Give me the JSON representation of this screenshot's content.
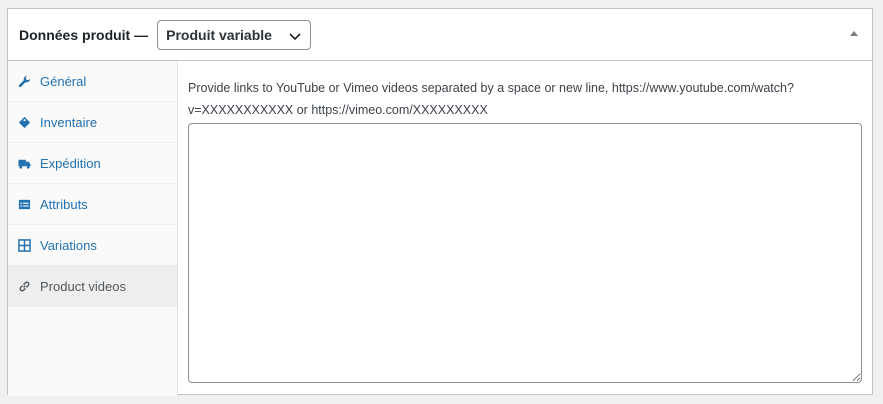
{
  "header": {
    "title": "Données produit —",
    "product_type": "Produit variable"
  },
  "tabs": [
    {
      "label": "Général",
      "icon": "wrench-icon"
    },
    {
      "label": "Inventaire",
      "icon": "tag-icon"
    },
    {
      "label": "Expédition",
      "icon": "truck-icon"
    },
    {
      "label": "Attributs",
      "icon": "list-icon"
    },
    {
      "label": "Variations",
      "icon": "grid-icon"
    },
    {
      "label": "Product videos",
      "icon": "link-icon"
    }
  ],
  "active_tab": "Product videos",
  "videos": {
    "description_line1": "Provide links to YouTube or Vimeo videos separated by a space or new line, https://www.youtube.com/watch?",
    "description_line2": "v=XXXXXXXXXXX or https://vimeo.com/XXXXXXXXX",
    "value": ""
  },
  "colors": {
    "link": "#2271b1",
    "active_tab_bg": "#eeeeee",
    "border": "#c3c4c7"
  }
}
